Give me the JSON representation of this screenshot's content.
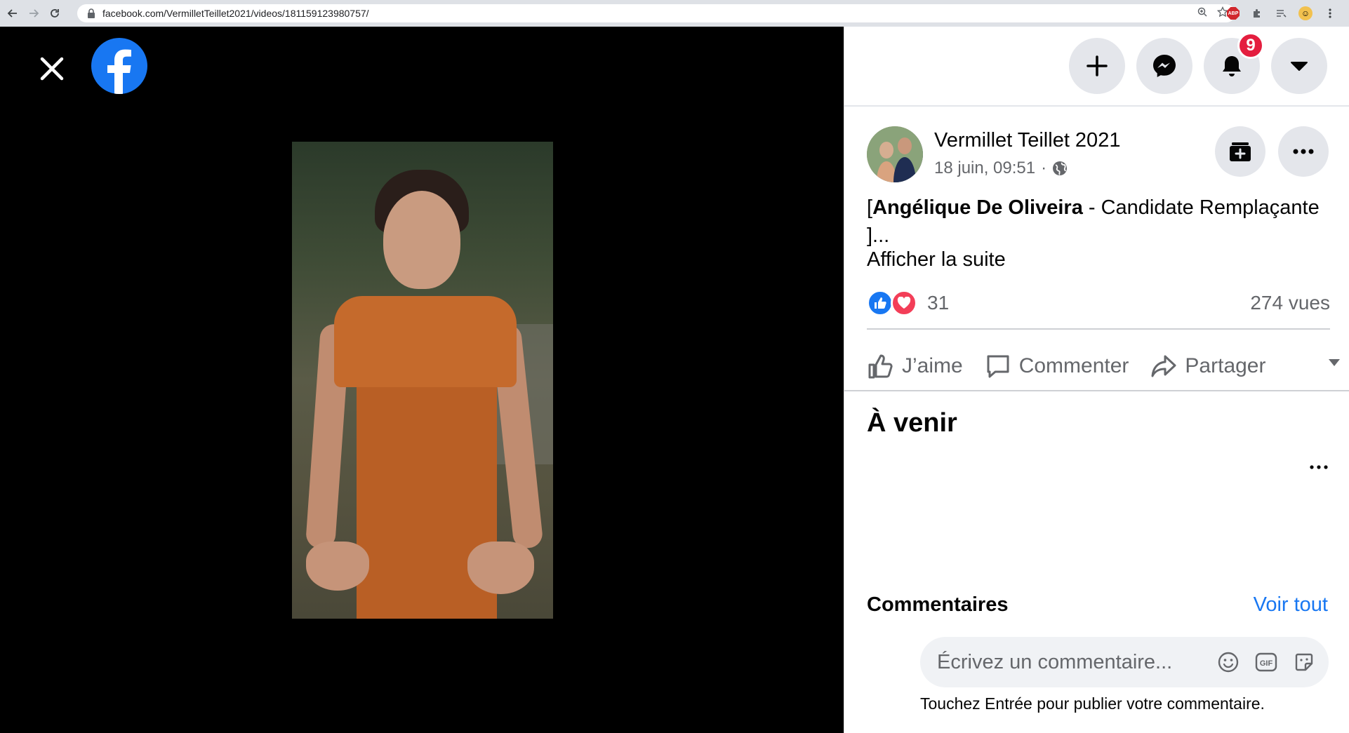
{
  "browser": {
    "url": "facebook.com/VermilletTeillet2021/videos/181159123980757/"
  },
  "topbar": {
    "notification_count": "9"
  },
  "post": {
    "page_name": "Vermillet Teillet 2021",
    "date": "18 juin, 09:51",
    "separator": "·",
    "text_open": "[",
    "text_name": "Angélique De Oliveira",
    "text_rest": " - Candidate Remplaçante",
    "text_line2": "]...",
    "see_more": "Afficher la suite",
    "reaction_count": "31",
    "views": "274 vues",
    "actions": {
      "like": "J’aime",
      "comment": "Commenter",
      "share": "Partager"
    }
  },
  "upcoming": {
    "title": "À venir"
  },
  "comments": {
    "title": "Commentaires",
    "see_all": "Voir tout",
    "placeholder": "Écrivez un commentaire...",
    "hint": "Touchez Entrée pour publier votre commentaire."
  },
  "colors": {
    "brand": "#1877f2",
    "badge": "#e41e3f",
    "love": "#f33e58"
  }
}
